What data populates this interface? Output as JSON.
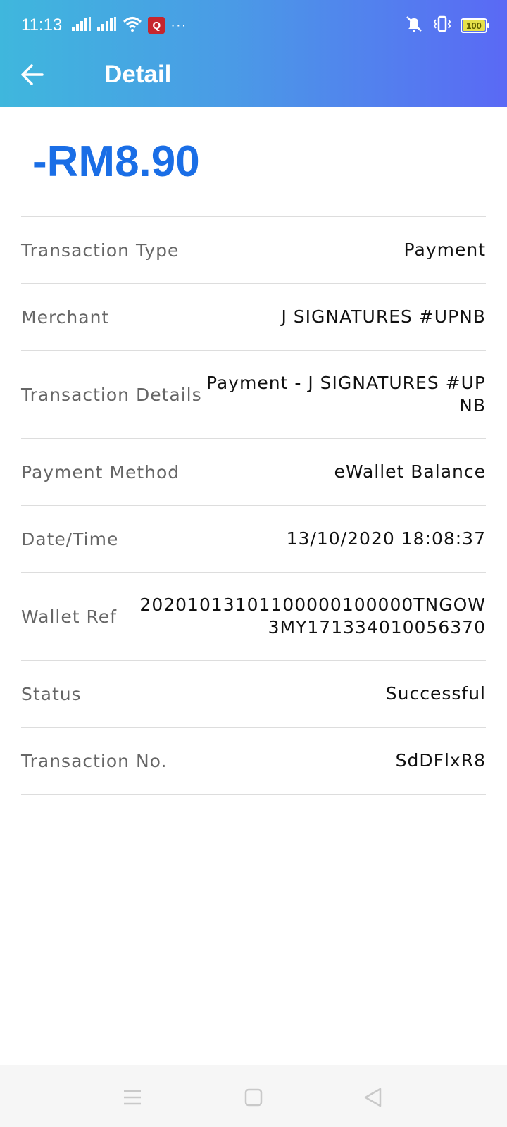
{
  "status_bar": {
    "time": "11:13",
    "badge_letter": "Q",
    "more": "···",
    "battery": "100",
    "icons": [
      "signal-icon",
      "signal-icon",
      "wifi-icon",
      "mute-icon",
      "vibrate-icon",
      "battery-icon"
    ]
  },
  "header": {
    "title": "Detail",
    "back_icon": "arrow-left-icon",
    "gradient": [
      "#3fb7dd",
      "#5a69f5"
    ]
  },
  "amount": "-RM8.90",
  "colors": {
    "amount": "#1a6ee6",
    "label": "#666666",
    "value": "#111111"
  },
  "details": [
    {
      "label": "Transaction Type",
      "value": "Payment"
    },
    {
      "label": "Merchant",
      "value": "J SIGNATURES #UPNB"
    },
    {
      "label": "Transaction Details",
      "value": "Payment - J SIGNATURES #UPNB"
    },
    {
      "label": "Payment Method",
      "value": "eWallet Balance"
    },
    {
      "label": "Date/Time",
      "value": "13/10/2020 18:08:37"
    },
    {
      "label": "Wallet Ref",
      "value": "20201013101100000100000TNGOW3MY171334010056370"
    },
    {
      "label": "Status",
      "value": "Successful"
    },
    {
      "label": "Transaction No.",
      "value": "SdDFlxR8"
    }
  ],
  "system_nav": {
    "icons": [
      "menu-icon",
      "home-icon",
      "back-triangle-icon"
    ]
  }
}
